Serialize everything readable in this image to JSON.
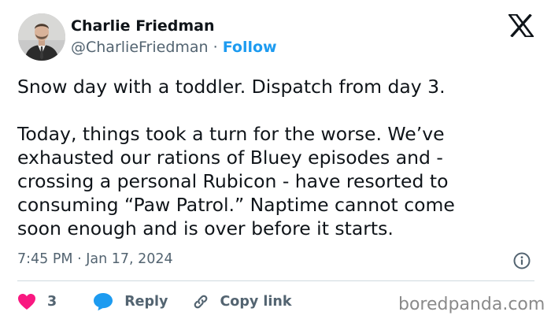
{
  "author": {
    "name": "Charlie Friedman",
    "handle": "@CharlieFriedman",
    "separator": " · ",
    "follow_label": "Follow"
  },
  "tweet": {
    "lines": [
      "Snow day with a toddler. Dispatch from day 3.",
      "",
      "Today, things took a turn for the worse. We’ve",
      "exhausted our rations of Bluey episodes and -",
      "crossing a personal Rubicon - have resorted to",
      "consuming “Paw Patrol.” Naptime cannot come",
      "soon enough and is over before it starts."
    ],
    "timestamp": "7:45 PM · Jan 17, 2024"
  },
  "actions": {
    "likes_count": "3",
    "reply_label": "Reply",
    "copy_link_label": "Copy link"
  },
  "icons": {
    "platform": "x-logo-icon",
    "like": "heart-icon",
    "reply": "speech-bubble-icon",
    "copy": "link-icon",
    "info": "info-icon"
  },
  "watermark": "boredpanda.com",
  "colors": {
    "text": "#0f1419",
    "muted": "#536471",
    "follow": "#1d9bf0",
    "heart": "#f91880",
    "reply_bubble": "#1d9bf0",
    "divider": "#cfd9de"
  }
}
